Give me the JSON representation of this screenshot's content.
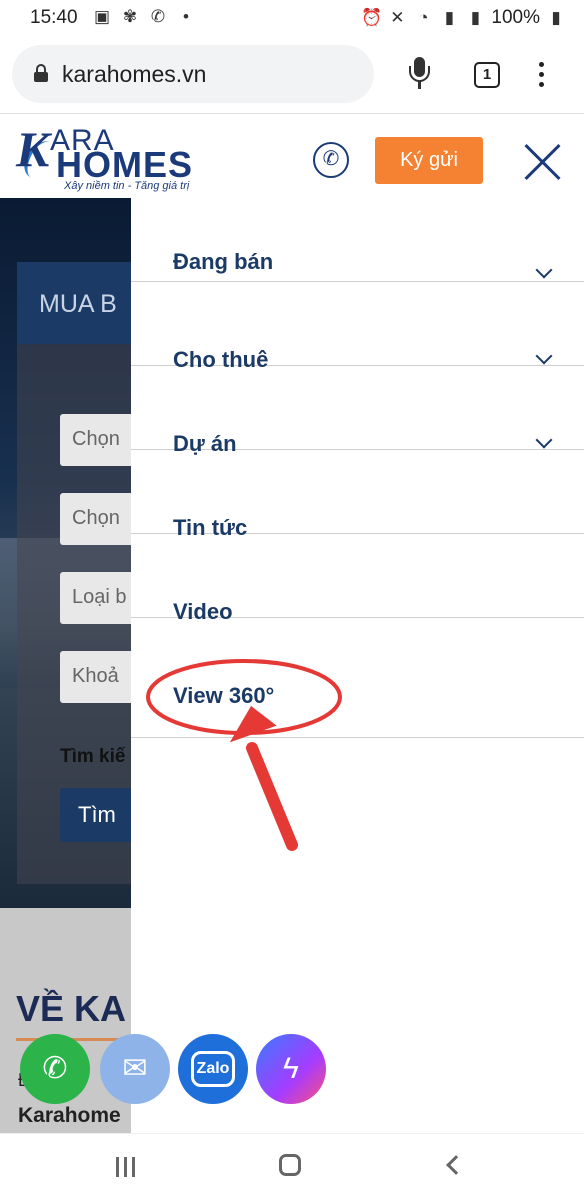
{
  "status_bar": {
    "time": "15:40",
    "battery": "100%"
  },
  "browser": {
    "url": "karahomes.vn",
    "tab_count": "1"
  },
  "header": {
    "logo_k": "K",
    "logo_ara": "ARA",
    "logo_homes": "HOMES",
    "logo_slogan": "Xây niềm tin - Tăng giá trị",
    "consign_button": "Ký gửi"
  },
  "background_page": {
    "search_title": "MUA B",
    "fields": [
      "Chọn",
      "Chọn",
      "Loại b",
      "Khoả"
    ],
    "find_label": "Tìm kiế",
    "find_button": "Tìm",
    "about_title": "VỀ KA",
    "about_sub1": "Đ    h",
    "about_sub2": "Karahome"
  },
  "menu": {
    "items": [
      {
        "label": "Đang bán",
        "has_submenu": true
      },
      {
        "label": "Cho thuê",
        "has_submenu": true
      },
      {
        "label": "Dự án",
        "has_submenu": true
      },
      {
        "label": "Tin tức",
        "has_submenu": false
      },
      {
        "label": "Video",
        "has_submenu": false
      },
      {
        "label": "View 360°",
        "has_submenu": false
      }
    ]
  },
  "colors": {
    "brand_navy": "#1b3a66",
    "accent_orange": "#f58233",
    "annotation_red": "#e53935"
  },
  "contacts": {
    "zalo_label": "Zalo"
  }
}
